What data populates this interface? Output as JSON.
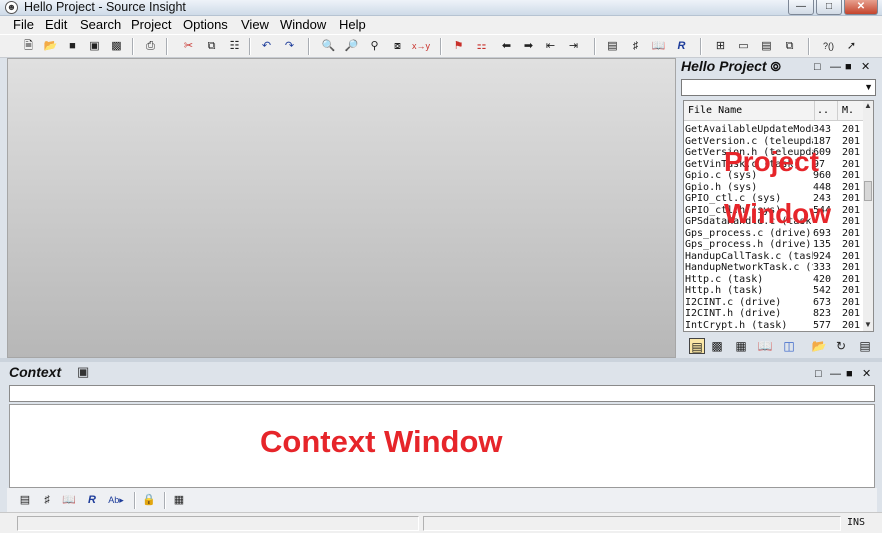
{
  "window": {
    "title": "Hello Project - Source Insight"
  },
  "menu": [
    "File",
    "Edit",
    "Search",
    "Project",
    "Options",
    "View",
    "Window",
    "Help"
  ],
  "project_window": {
    "title": "Hello Project",
    "columns": {
      "name": "File Name",
      "size": "..",
      "modified": "M."
    },
    "files": [
      {
        "name": "GetAvailableUpdateModu",
        "size": "343",
        "modified": "201"
      },
      {
        "name": "GetVersion.c (teleupda",
        "size": "187",
        "modified": "201"
      },
      {
        "name": "GetVersion.h (teleupda",
        "size": "609",
        "modified": "201"
      },
      {
        "name": "GetVinTask.c (task)",
        "size": "97",
        "modified": "201"
      },
      {
        "name": "Gpio.c (sys)",
        "size": "960",
        "modified": "201"
      },
      {
        "name": "Gpio.h (sys)",
        "size": "448",
        "modified": "201"
      },
      {
        "name": "GPIO_ctl.c (sys)",
        "size": "243",
        "modified": "201"
      },
      {
        "name": "GPIO_ctl.h (sys)",
        "size": "544",
        "modified": "201"
      },
      {
        "name": "GPSdataHandle.c (task)",
        "size": "",
        "modified": "201"
      },
      {
        "name": "Gps_process.c (drive)",
        "size": "693",
        "modified": "201"
      },
      {
        "name": "Gps_process.h (drive)",
        "size": "135",
        "modified": "201"
      },
      {
        "name": "HandupCallTask.c (task",
        "size": "924",
        "modified": "201"
      },
      {
        "name": "HandupNetworkTask.c (t",
        "size": "333",
        "modified": "201"
      },
      {
        "name": "Http.c (task)",
        "size": "420",
        "modified": "201"
      },
      {
        "name": "Http.h (task)",
        "size": "542",
        "modified": "201"
      },
      {
        "name": "I2CINT.c (drive)",
        "size": "673",
        "modified": "201"
      },
      {
        "name": "I2CINT.h (drive)",
        "size": "823",
        "modified": "201"
      },
      {
        "name": "IntCrypt.h (task)",
        "size": "577",
        "modified": "201"
      }
    ],
    "overlay_line1": "Project",
    "overlay_line2": "Window"
  },
  "context_window": {
    "title": "Context",
    "overlay": "Context Window"
  },
  "status": {
    "mode": "INS"
  },
  "colors": {
    "overlay": "#e6252a",
    "toolbar_red": "#c8302a"
  }
}
